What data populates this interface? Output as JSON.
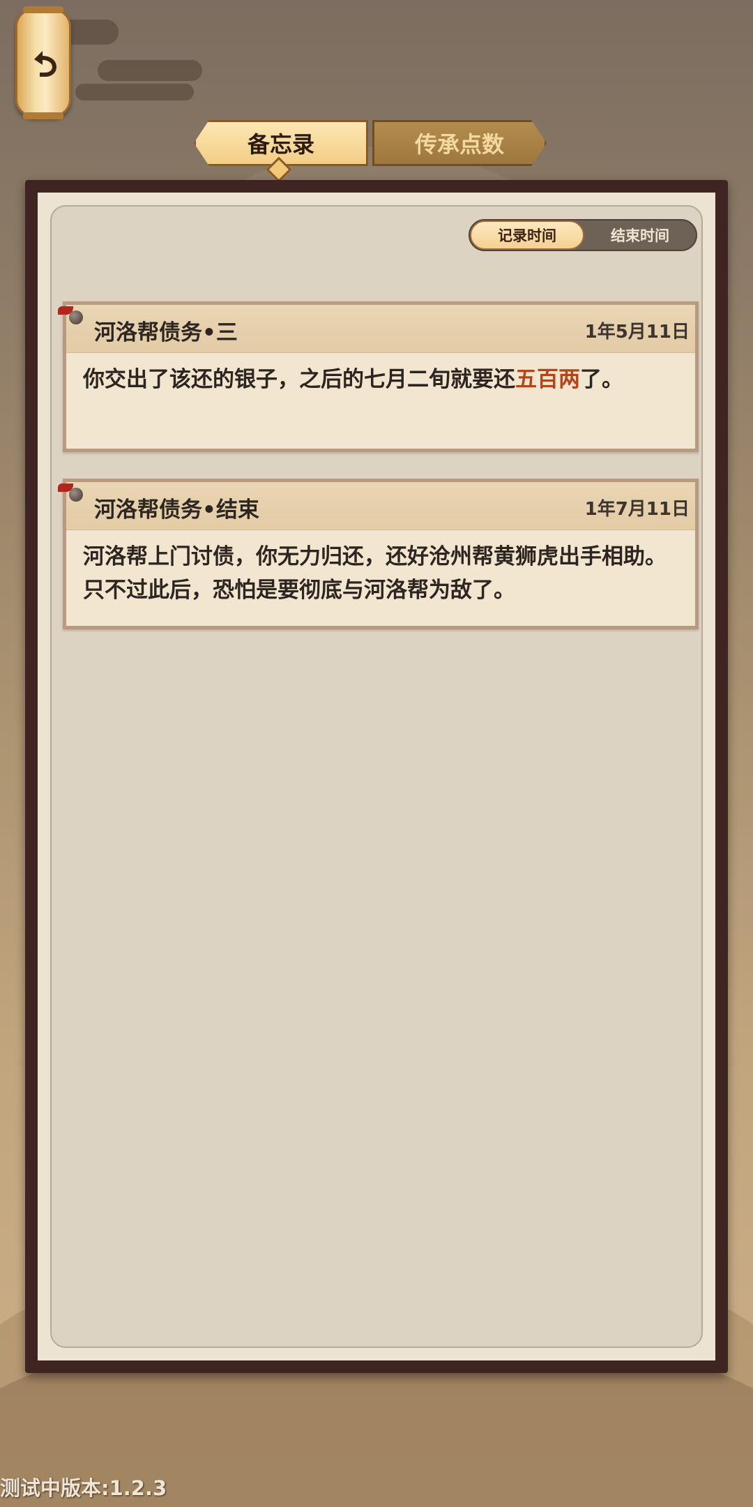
{
  "nav": {
    "back_icon": "undo-arrow-icon"
  },
  "tabs": [
    {
      "label": "备忘录",
      "active": true
    },
    {
      "label": "传承点数",
      "active": false
    }
  ],
  "sort": {
    "options": [
      "记录时间",
      "结束时间"
    ],
    "selected": "记录时间"
  },
  "memos": [
    {
      "title": "河洛帮债务•三",
      "date": "1年5月11日",
      "body_before": "你交出了该还的银子，之后的七月二旬就要还",
      "body_highlight": "五百两",
      "body_after": "了。"
    },
    {
      "title": "河洛帮债务•结束",
      "date": "1年7月11日",
      "body": "河洛帮上门讨债，你无力归还，还好沧州帮黄狮虎出手相助。只不过此后，恐怕是要彻底与河洛帮为敌了。"
    }
  ],
  "version_text": "测试中版本:1.2.3",
  "colors": {
    "frame": "#3e2522",
    "paper": "#ddd3c3",
    "card": "#f2e6d1",
    "highlight": "#b2461a",
    "tab_active": "#f3cd85",
    "tab_inactive": "#9d773e"
  }
}
